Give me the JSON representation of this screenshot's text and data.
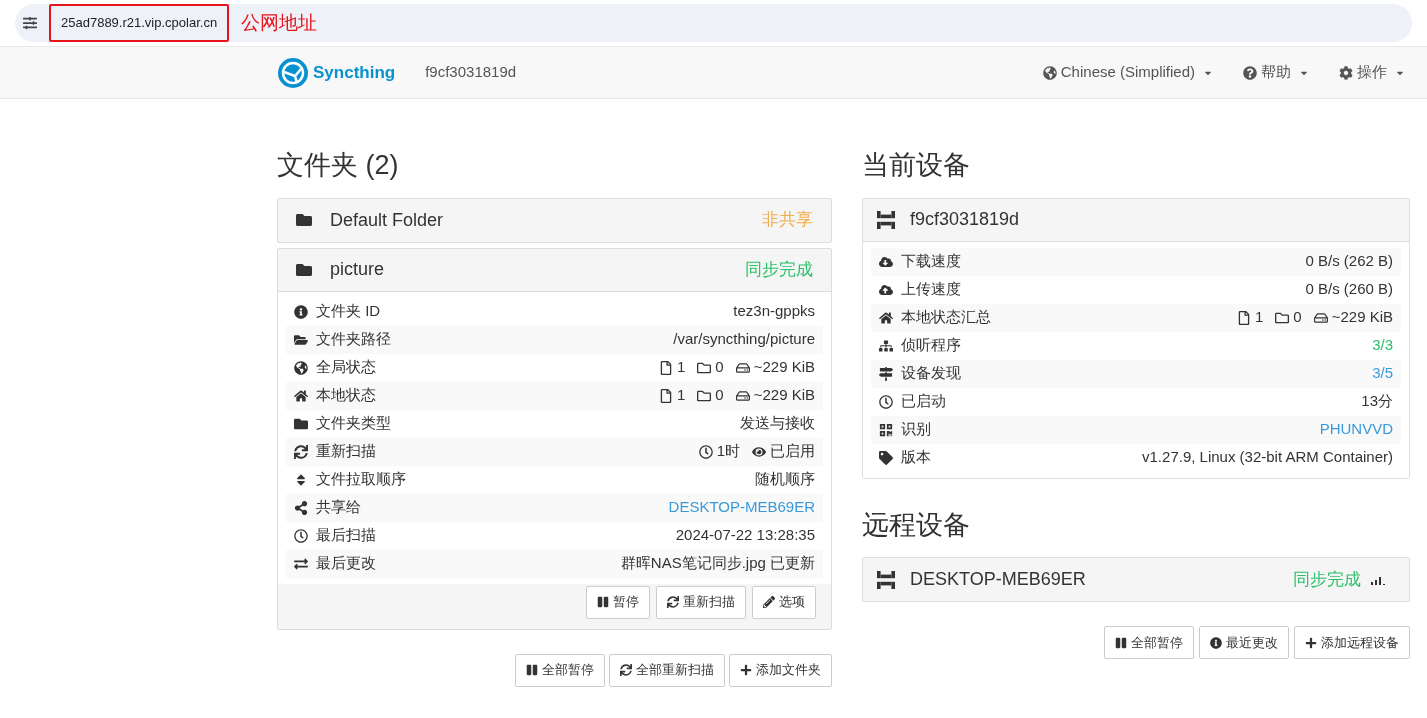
{
  "browser": {
    "address": "25ad7889.r21.vip.cpolar.cn",
    "annotation": "公网地址"
  },
  "navbar": {
    "brand": "Syncthing",
    "device_name": "f9cf3031819d",
    "menus": [
      {
        "label": "Chinese (Simplified)"
      },
      {
        "label": "帮助"
      },
      {
        "label": "操作"
      }
    ]
  },
  "folders": {
    "title": "文件夹 (2)",
    "items": [
      {
        "name": "Default Folder",
        "status": "非共享",
        "color": "#f0ad4e",
        "expanded": false
      },
      {
        "name": "picture",
        "status": "同步完成",
        "color": "#2cc16b",
        "expanded": true,
        "rows": [
          {
            "label": "文件夹 ID",
            "kind": "text",
            "value": "tez3n-gppks"
          },
          {
            "label": "文件夹路径",
            "kind": "text",
            "value": "/var/syncthing/picture"
          },
          {
            "label": "全局状态",
            "kind": "stats",
            "values": [
              "1",
              "0",
              "~229 KiB"
            ]
          },
          {
            "label": "本地状态",
            "kind": "stats",
            "values": [
              "1",
              "0",
              "~229 KiB"
            ]
          },
          {
            "label": "文件夹类型",
            "kind": "text",
            "value": "发送与接收"
          },
          {
            "label": "重新扫描",
            "kind": "rescan",
            "values": [
              "1时",
              "已启用"
            ]
          },
          {
            "label": "文件拉取顺序",
            "kind": "text",
            "value": "随机顺序"
          },
          {
            "label": "共享给",
            "kind": "link",
            "value": "DESKTOP-MEB69ER"
          },
          {
            "label": "最后扫描",
            "kind": "text",
            "value": "2024-07-22 13:28:35"
          },
          {
            "label": "最后更改",
            "kind": "text",
            "value": "群晖NAS笔记同步.jpg 已更新"
          }
        ],
        "buttons": [
          "暂停",
          "重新扫描",
          "选项"
        ]
      }
    ],
    "buttons": [
      "全部暂停",
      "全部重新扫描",
      "添加文件夹"
    ]
  },
  "this_device": {
    "title": "当前设备",
    "name": "f9cf3031819d",
    "rows": [
      {
        "label": "下载速度",
        "kind": "text",
        "value": "0 B/s (262 B)"
      },
      {
        "label": "上传速度",
        "kind": "text",
        "value": "0 B/s (260 B)"
      },
      {
        "label": "本地状态汇总",
        "kind": "stats",
        "values": [
          "1",
          "0",
          "~229 KiB"
        ]
      },
      {
        "label": "侦听程序",
        "kind": "success",
        "value": "3/3"
      },
      {
        "label": "设备发现",
        "kind": "link",
        "value": "3/5"
      },
      {
        "label": "已启动",
        "kind": "text",
        "value": "13分"
      },
      {
        "label": "识别",
        "kind": "link",
        "value": "PHUNVVD"
      },
      {
        "label": "版本",
        "kind": "text",
        "value": "v1.27.9, Linux (32-bit ARM Container)"
      }
    ]
  },
  "remote_devices": {
    "title": "远程设备",
    "items": [
      {
        "name": "DESKTOP-MEB69ER",
        "status": "同步完成",
        "color": "#2cc16b"
      }
    ],
    "buttons": [
      "全部暂停",
      "最近更改",
      "添加远程设备"
    ]
  }
}
